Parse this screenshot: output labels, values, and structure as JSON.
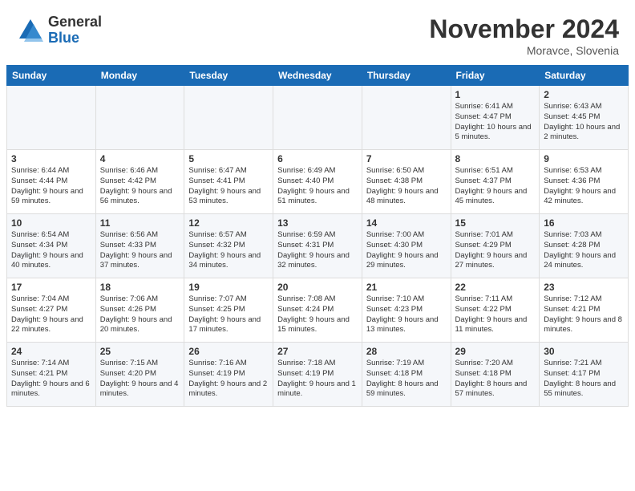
{
  "logo": {
    "general": "General",
    "blue": "Blue"
  },
  "title": "November 2024",
  "location": "Moravce, Slovenia",
  "weekdays": [
    "Sunday",
    "Monday",
    "Tuesday",
    "Wednesday",
    "Thursday",
    "Friday",
    "Saturday"
  ],
  "weeks": [
    [
      {
        "day": "",
        "info": ""
      },
      {
        "day": "",
        "info": ""
      },
      {
        "day": "",
        "info": ""
      },
      {
        "day": "",
        "info": ""
      },
      {
        "day": "",
        "info": ""
      },
      {
        "day": "1",
        "info": "Sunrise: 6:41 AM\nSunset: 4:47 PM\nDaylight: 10 hours and 5 minutes."
      },
      {
        "day": "2",
        "info": "Sunrise: 6:43 AM\nSunset: 4:45 PM\nDaylight: 10 hours and 2 minutes."
      }
    ],
    [
      {
        "day": "3",
        "info": "Sunrise: 6:44 AM\nSunset: 4:44 PM\nDaylight: 9 hours and 59 minutes."
      },
      {
        "day": "4",
        "info": "Sunrise: 6:46 AM\nSunset: 4:42 PM\nDaylight: 9 hours and 56 minutes."
      },
      {
        "day": "5",
        "info": "Sunrise: 6:47 AM\nSunset: 4:41 PM\nDaylight: 9 hours and 53 minutes."
      },
      {
        "day": "6",
        "info": "Sunrise: 6:49 AM\nSunset: 4:40 PM\nDaylight: 9 hours and 51 minutes."
      },
      {
        "day": "7",
        "info": "Sunrise: 6:50 AM\nSunset: 4:38 PM\nDaylight: 9 hours and 48 minutes."
      },
      {
        "day": "8",
        "info": "Sunrise: 6:51 AM\nSunset: 4:37 PM\nDaylight: 9 hours and 45 minutes."
      },
      {
        "day": "9",
        "info": "Sunrise: 6:53 AM\nSunset: 4:36 PM\nDaylight: 9 hours and 42 minutes."
      }
    ],
    [
      {
        "day": "10",
        "info": "Sunrise: 6:54 AM\nSunset: 4:34 PM\nDaylight: 9 hours and 40 minutes."
      },
      {
        "day": "11",
        "info": "Sunrise: 6:56 AM\nSunset: 4:33 PM\nDaylight: 9 hours and 37 minutes."
      },
      {
        "day": "12",
        "info": "Sunrise: 6:57 AM\nSunset: 4:32 PM\nDaylight: 9 hours and 34 minutes."
      },
      {
        "day": "13",
        "info": "Sunrise: 6:59 AM\nSunset: 4:31 PM\nDaylight: 9 hours and 32 minutes."
      },
      {
        "day": "14",
        "info": "Sunrise: 7:00 AM\nSunset: 4:30 PM\nDaylight: 9 hours and 29 minutes."
      },
      {
        "day": "15",
        "info": "Sunrise: 7:01 AM\nSunset: 4:29 PM\nDaylight: 9 hours and 27 minutes."
      },
      {
        "day": "16",
        "info": "Sunrise: 7:03 AM\nSunset: 4:28 PM\nDaylight: 9 hours and 24 minutes."
      }
    ],
    [
      {
        "day": "17",
        "info": "Sunrise: 7:04 AM\nSunset: 4:27 PM\nDaylight: 9 hours and 22 minutes."
      },
      {
        "day": "18",
        "info": "Sunrise: 7:06 AM\nSunset: 4:26 PM\nDaylight: 9 hours and 20 minutes."
      },
      {
        "day": "19",
        "info": "Sunrise: 7:07 AM\nSunset: 4:25 PM\nDaylight: 9 hours and 17 minutes."
      },
      {
        "day": "20",
        "info": "Sunrise: 7:08 AM\nSunset: 4:24 PM\nDaylight: 9 hours and 15 minutes."
      },
      {
        "day": "21",
        "info": "Sunrise: 7:10 AM\nSunset: 4:23 PM\nDaylight: 9 hours and 13 minutes."
      },
      {
        "day": "22",
        "info": "Sunrise: 7:11 AM\nSunset: 4:22 PM\nDaylight: 9 hours and 11 minutes."
      },
      {
        "day": "23",
        "info": "Sunrise: 7:12 AM\nSunset: 4:21 PM\nDaylight: 9 hours and 8 minutes."
      }
    ],
    [
      {
        "day": "24",
        "info": "Sunrise: 7:14 AM\nSunset: 4:21 PM\nDaylight: 9 hours and 6 minutes."
      },
      {
        "day": "25",
        "info": "Sunrise: 7:15 AM\nSunset: 4:20 PM\nDaylight: 9 hours and 4 minutes."
      },
      {
        "day": "26",
        "info": "Sunrise: 7:16 AM\nSunset: 4:19 PM\nDaylight: 9 hours and 2 minutes."
      },
      {
        "day": "27",
        "info": "Sunrise: 7:18 AM\nSunset: 4:19 PM\nDaylight: 9 hours and 1 minute."
      },
      {
        "day": "28",
        "info": "Sunrise: 7:19 AM\nSunset: 4:18 PM\nDaylight: 8 hours and 59 minutes."
      },
      {
        "day": "29",
        "info": "Sunrise: 7:20 AM\nSunset: 4:18 PM\nDaylight: 8 hours and 57 minutes."
      },
      {
        "day": "30",
        "info": "Sunrise: 7:21 AM\nSunset: 4:17 PM\nDaylight: 8 hours and 55 minutes."
      }
    ]
  ]
}
